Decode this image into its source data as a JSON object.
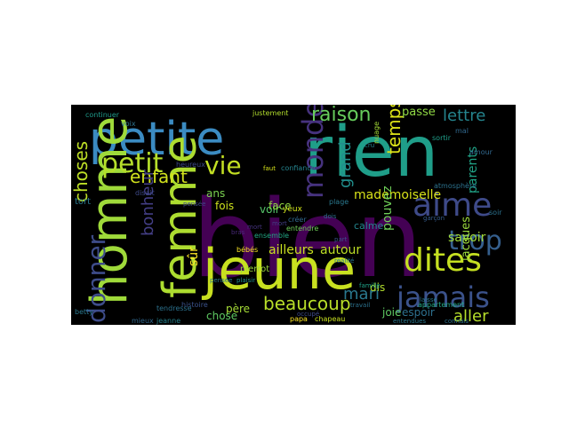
{
  "wordcloud": {
    "background": "#000000",
    "colormap": "viridis",
    "words": [
      {
        "text": "bien",
        "color": "#440154"
      },
      {
        "text": "rien",
        "color": "#1f9e89"
      },
      {
        "text": "petite",
        "color": "#3b8bc2"
      },
      {
        "text": "jeune",
        "color": "#c8e020"
      },
      {
        "text": "homme",
        "color": "#9fda3a"
      },
      {
        "text": "femme",
        "color": "#addc30"
      },
      {
        "text": "dites",
        "color": "#c5e021"
      },
      {
        "text": "aime",
        "color": "#3e4a89"
      },
      {
        "text": "trop",
        "color": "#355f8d"
      },
      {
        "text": "jamais",
        "color": "#3b528b"
      },
      {
        "text": "monde",
        "color": "#46327e"
      },
      {
        "text": "petit",
        "color": "#b5de2b"
      },
      {
        "text": "vie",
        "color": "#c2df23"
      },
      {
        "text": "raison",
        "color": "#67cc5c"
      },
      {
        "text": "lettre",
        "color": "#25858e"
      },
      {
        "text": "donner",
        "color": "#3e4c8a"
      },
      {
        "text": "choses",
        "color": "#bddf26"
      },
      {
        "text": "enfant",
        "color": "#d0e11c"
      },
      {
        "text": "temps",
        "color": "#dde318"
      },
      {
        "text": "beaucoup",
        "color": "#b8de29"
      },
      {
        "text": "mari",
        "color": "#2a788e"
      },
      {
        "text": "aller",
        "color": "#b5de2b"
      },
      {
        "text": "bonheur",
        "color": "#433e85"
      },
      {
        "text": "grand",
        "color": "#218f8d"
      },
      {
        "text": "mademoiselle",
        "color": "#d8e219"
      },
      {
        "text": "ailleurs",
        "color": "#c8e020"
      },
      {
        "text": "autour",
        "color": "#bddf26"
      },
      {
        "text": "savoir",
        "color": "#a0da39"
      },
      {
        "text": "espoir",
        "color": "#2d708e"
      },
      {
        "text": "parents",
        "color": "#20a386"
      },
      {
        "text": "pouvez",
        "color": "#6ece58"
      },
      {
        "text": "jacques",
        "color": "#9bd93c"
      },
      {
        "text": "passe",
        "color": "#8fd744"
      },
      {
        "text": "ans",
        "color": "#7ad151"
      },
      {
        "text": "voir",
        "color": "#54c568"
      },
      {
        "text": "fois",
        "color": "#cde11d"
      },
      {
        "text": "face",
        "color": "#93d741"
      },
      {
        "text": "sûr",
        "color": "#fde725"
      },
      {
        "text": "père",
        "color": "#a5db36"
      },
      {
        "text": "chose",
        "color": "#5ec962"
      },
      {
        "text": "dis",
        "color": "#b2dd2d"
      },
      {
        "text": "joie",
        "color": "#5ec962"
      },
      {
        "text": "calme",
        "color": "#24868e"
      },
      {
        "text": "pierrot",
        "color": "#9bd93c"
      },
      {
        "text": "tort",
        "color": "#2a788e"
      },
      {
        "text": "bébés",
        "color": "#fde725"
      },
      {
        "text": "yeux",
        "color": "#d0e11c"
      },
      {
        "text": "créer",
        "color": "#31688e"
      },
      {
        "text": "entendre",
        "color": "#6ece58"
      },
      {
        "text": "ensemble",
        "color": "#22a884"
      },
      {
        "text": "papa",
        "color": "#fde725"
      },
      {
        "text": "chapeau",
        "color": "#c8e020"
      },
      {
        "text": "histoire",
        "color": "#3b528b"
      },
      {
        "text": "mieux",
        "color": "#31688e"
      },
      {
        "text": "jeanne",
        "color": "#26828e"
      },
      {
        "text": "tendresse",
        "color": "#2c728e"
      },
      {
        "text": "betty",
        "color": "#2a788e"
      },
      {
        "text": "continuer",
        "color": "#1f9a8a"
      },
      {
        "text": "justement",
        "color": "#b2dd2d"
      },
      {
        "text": "voix",
        "color": "#2c728e"
      },
      {
        "text": "heureux",
        "color": "#3e4a89"
      },
      {
        "text": "confiance",
        "color": "#25848e"
      },
      {
        "text": "pensée",
        "color": "#3f4788"
      },
      {
        "text": "appartement",
        "color": "#22a884"
      },
      {
        "text": "atmosphère",
        "color": "#2c728e"
      },
      {
        "text": "disait",
        "color": "#3e4a89"
      },
      {
        "text": "plage",
        "color": "#2a788e"
      },
      {
        "text": "sortir",
        "color": "#1f9e89"
      },
      {
        "text": "soir",
        "color": "#2c728e"
      },
      {
        "text": "amour",
        "color": "#31688e"
      },
      {
        "text": "nuage",
        "color": "#a5db36"
      },
      {
        "text": "mal",
        "color": "#31688e"
      },
      {
        "text": "laisse",
        "color": "#2a788e"
      },
      {
        "text": "connais",
        "color": "#2c728e"
      },
      {
        "text": "entendues",
        "color": "#2a788e"
      },
      {
        "text": "garçon",
        "color": "#365c8d"
      },
      {
        "text": "travail",
        "color": "#2c728e"
      },
      {
        "text": "famille",
        "color": "#1fa187"
      },
      {
        "text": "mort",
        "color": "#46337f"
      },
      {
        "text": "faut",
        "color": "#d5e21a"
      },
      {
        "text": "cru",
        "color": "#26828e"
      },
      {
        "text": "dois",
        "color": "#2c728e"
      },
      {
        "text": "part",
        "color": "#3b528b"
      },
      {
        "text": "réalité",
        "color": "#2a788e"
      },
      {
        "text": "occupé",
        "color": "#3e4a89"
      },
      {
        "text": "mort",
        "color": "#433e85"
      },
      {
        "text": "bras",
        "color": "#482878"
      },
      {
        "text": "plaisir",
        "color": "#21918c"
      },
      {
        "text": "pensée",
        "color": "#2a788e"
      }
    ]
  }
}
